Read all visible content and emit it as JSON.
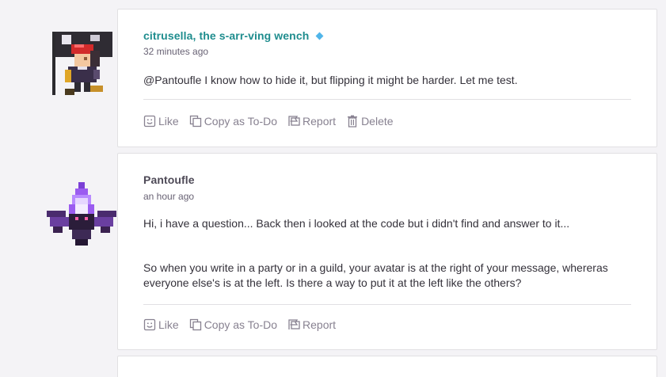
{
  "messages": [
    {
      "author": "citrusella, the s-arr-ving wench",
      "time": "32 minutes ago",
      "text": "@Pantoufle I know how to hide it, but flipping it might be harder. Let me test.",
      "actions": {
        "like": "Like",
        "copy_todo": "Copy as To-Do",
        "report": "Report",
        "delete": "Delete"
      }
    },
    {
      "author": "Pantoufle",
      "time": "an hour ago",
      "paragraphs": [
        "Hi, i have a question... Back then i looked at the code but i didn't find and answer to it...",
        "So when you write in a party or in a guild, your avatar is at the right of your message, whereras everyone else's is at the left. Is there a way to put it at the left like the others?"
      ],
      "actions": {
        "like": "Like",
        "copy_todo": "Copy as To-Do",
        "report": "Report"
      }
    }
  ],
  "colors": {
    "author_highlight": "#1f8d8e",
    "author_default": "#4e4a57",
    "badge": "#50b5e9",
    "action_text": "#878190"
  },
  "icons": [
    "like-icon",
    "copy-icon",
    "report-icon",
    "delete-icon",
    "badge-icon"
  ]
}
